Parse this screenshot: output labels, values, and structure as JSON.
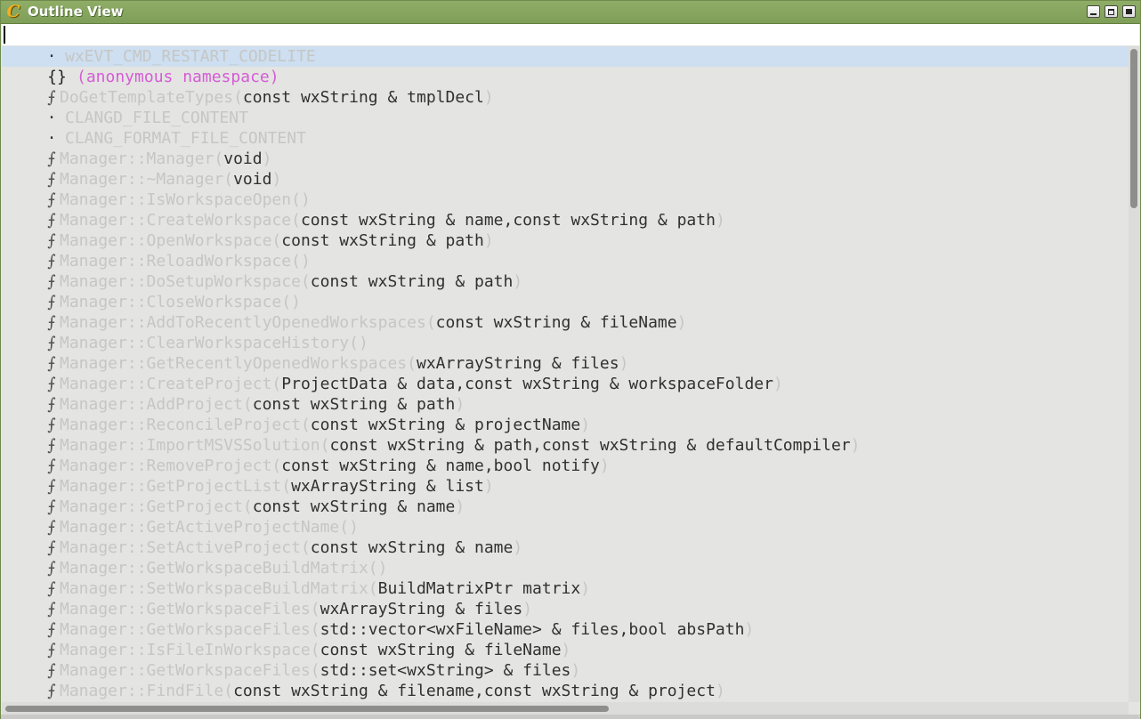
{
  "window": {
    "title": "Outline View",
    "app_icon_glyph": "C",
    "accent_color": "#7f9e58"
  },
  "search": {
    "value": "",
    "placeholder": ""
  },
  "outline": {
    "items": [
      {
        "kind": "variable",
        "icon": "·",
        "name": "wxEVT_CMD_RESTART_CODELITE",
        "open": "",
        "params": "",
        "close": "",
        "selected": true
      },
      {
        "kind": "namespace",
        "icon": "{}",
        "name": "(anonymous namespace)",
        "open": "",
        "params": "",
        "close": ""
      },
      {
        "kind": "function",
        "icon": "⨍",
        "name": "DoGetTemplateTypes",
        "open": "(",
        "params": "const wxString & tmplDecl",
        "close": ")"
      },
      {
        "kind": "variable",
        "icon": "·",
        "name": "CLANGD_FILE_CONTENT",
        "open": "",
        "params": "",
        "close": ""
      },
      {
        "kind": "variable",
        "icon": "·",
        "name": "CLANG_FORMAT_FILE_CONTENT",
        "open": "",
        "params": "",
        "close": ""
      },
      {
        "kind": "function",
        "icon": "⨍",
        "name": "Manager::Manager",
        "open": "(",
        "params": "void",
        "close": ")"
      },
      {
        "kind": "function",
        "icon": "⨍",
        "name": "Manager::~Manager",
        "open": "(",
        "params": "void",
        "close": ")"
      },
      {
        "kind": "function",
        "icon": "⨍",
        "name": "Manager::IsWorkspaceOpen",
        "open": "(",
        "params": "",
        "close": ")"
      },
      {
        "kind": "function",
        "icon": "⨍",
        "name": "Manager::CreateWorkspace",
        "open": "(",
        "params": "const wxString & name,const wxString & path",
        "close": ")"
      },
      {
        "kind": "function",
        "icon": "⨍",
        "name": "Manager::OpenWorkspace",
        "open": "(",
        "params": "const wxString & path",
        "close": ")"
      },
      {
        "kind": "function",
        "icon": "⨍",
        "name": "Manager::ReloadWorkspace",
        "open": "(",
        "params": "",
        "close": ")"
      },
      {
        "kind": "function",
        "icon": "⨍",
        "name": "Manager::DoSetupWorkspace",
        "open": "(",
        "params": "const wxString & path",
        "close": ")"
      },
      {
        "kind": "function",
        "icon": "⨍",
        "name": "Manager::CloseWorkspace",
        "open": "(",
        "params": "",
        "close": ")"
      },
      {
        "kind": "function",
        "icon": "⨍",
        "name": "Manager::AddToRecentlyOpenedWorkspaces",
        "open": "(",
        "params": "const wxString & fileName",
        "close": ")"
      },
      {
        "kind": "function",
        "icon": "⨍",
        "name": "Manager::ClearWorkspaceHistory",
        "open": "(",
        "params": "",
        "close": ")"
      },
      {
        "kind": "function",
        "icon": "⨍",
        "name": "Manager::GetRecentlyOpenedWorkspaces",
        "open": "(",
        "params": "wxArrayString & files",
        "close": ")"
      },
      {
        "kind": "function",
        "icon": "⨍",
        "name": "Manager::CreateProject",
        "open": "(",
        "params": "ProjectData & data,const wxString & workspaceFolder",
        "close": ")"
      },
      {
        "kind": "function",
        "icon": "⨍",
        "name": "Manager::AddProject",
        "open": "(",
        "params": "const wxString & path",
        "close": ")"
      },
      {
        "kind": "function",
        "icon": "⨍",
        "name": "Manager::ReconcileProject",
        "open": "(",
        "params": "const wxString & projectName",
        "close": ")"
      },
      {
        "kind": "function",
        "icon": "⨍",
        "name": "Manager::ImportMSVSSolution",
        "open": "(",
        "params": "const wxString & path,const wxString & defaultCompiler",
        "close": ")"
      },
      {
        "kind": "function",
        "icon": "⨍",
        "name": "Manager::RemoveProject",
        "open": "(",
        "params": "const wxString & name,bool notify",
        "close": ")"
      },
      {
        "kind": "function",
        "icon": "⨍",
        "name": "Manager::GetProjectList",
        "open": "(",
        "params": "wxArrayString & list",
        "close": ")"
      },
      {
        "kind": "function",
        "icon": "⨍",
        "name": "Manager::GetProject",
        "open": "(",
        "params": "const wxString & name",
        "close": ")"
      },
      {
        "kind": "function",
        "icon": "⨍",
        "name": "Manager::GetActiveProjectName",
        "open": "(",
        "params": "",
        "close": ")"
      },
      {
        "kind": "function",
        "icon": "⨍",
        "name": "Manager::SetActiveProject",
        "open": "(",
        "params": "const wxString & name",
        "close": ")"
      },
      {
        "kind": "function",
        "icon": "⨍",
        "name": "Manager::GetWorkspaceBuildMatrix",
        "open": "(",
        "params": "",
        "close": ")"
      },
      {
        "kind": "function",
        "icon": "⨍",
        "name": "Manager::SetWorkspaceBuildMatrix",
        "open": "(",
        "params": "BuildMatrixPtr matrix",
        "close": ")"
      },
      {
        "kind": "function",
        "icon": "⨍",
        "name": "Manager::GetWorkspaceFiles",
        "open": "(",
        "params": "wxArrayString & files",
        "close": ")"
      },
      {
        "kind": "function",
        "icon": "⨍",
        "name": "Manager::GetWorkspaceFiles",
        "open": "(",
        "params": "std::vector<wxFileName> & files,bool absPath",
        "close": ")"
      },
      {
        "kind": "function",
        "icon": "⨍",
        "name": "Manager::IsFileInWorkspace",
        "open": "(",
        "params": "const wxString & fileName",
        "close": ")"
      },
      {
        "kind": "function",
        "icon": "⨍",
        "name": "Manager::GetWorkspaceFiles",
        "open": "(",
        "params": "std::set<wxString> & files",
        "close": ")"
      },
      {
        "kind": "function",
        "icon": "⨍",
        "name": "Manager::FindFile",
        "open": "(",
        "params": "const wxString & filename,const wxString & project",
        "close": ")"
      }
    ]
  },
  "colors": {
    "selection": "#cddff0",
    "namespace_text": "#d55cd5",
    "dim_text": "#c6c6c6",
    "signature_text": "#303030"
  }
}
